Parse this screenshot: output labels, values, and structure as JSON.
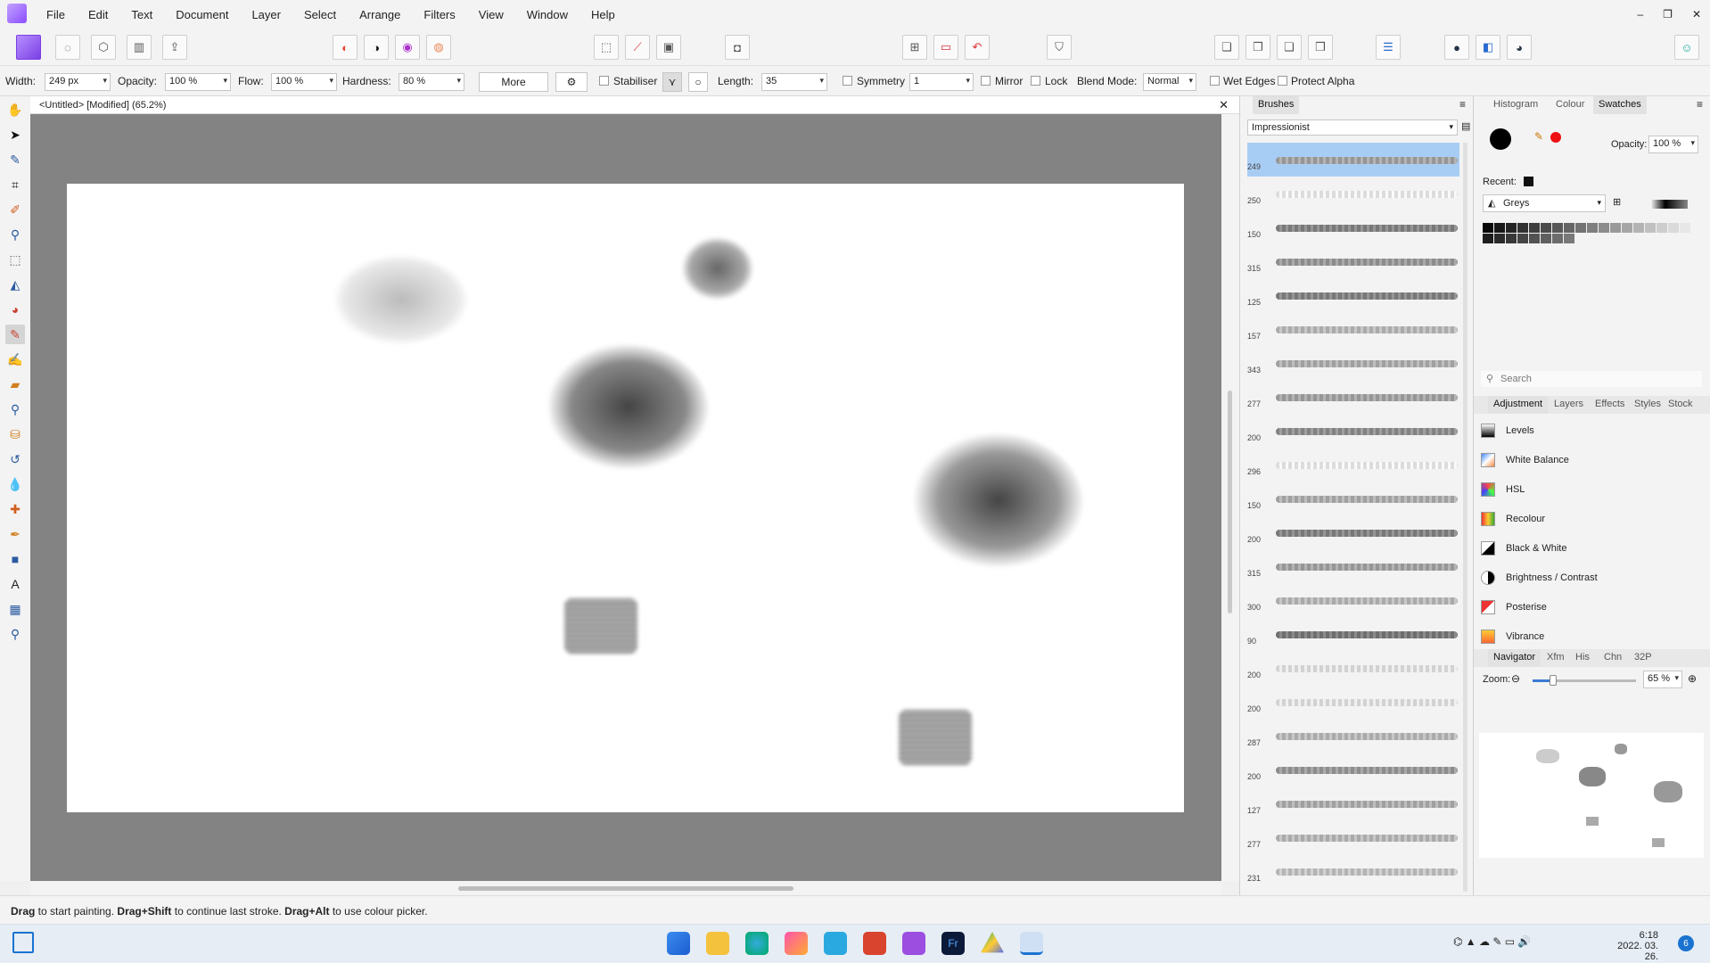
{
  "app": {
    "name": "Affinity Photo"
  },
  "menu": [
    "File",
    "Edit",
    "Text",
    "Document",
    "Layer",
    "Select",
    "Arrange",
    "Filters",
    "View",
    "Window",
    "Help"
  ],
  "window_controls": [
    "–",
    "❐",
    "✕"
  ],
  "context": {
    "width_label": "Width:",
    "width_value": "249 px",
    "opacity_label": "Opacity:",
    "opacity_value": "100 %",
    "flow_label": "Flow:",
    "flow_value": "100 %",
    "hardness_label": "Hardness:",
    "hardness_value": "80 %",
    "more_label": "More",
    "stabiliser_label": "Stabiliser",
    "length_label": "Length:",
    "length_value": "35",
    "symmetry_label": "Symmetry",
    "symmetry_value": "1",
    "mirror_label": "Mirror",
    "lock_label": "Lock",
    "blend_label": "Blend Mode:",
    "blend_value": "Normal",
    "wet_edges_label": "Wet Edges",
    "protect_alpha_label": "Protect Alpha"
  },
  "document": {
    "title": "<Untitled> [Modified] (65.2%)"
  },
  "brushes": {
    "tab": "Brushes",
    "category": "Impressionist",
    "sizes": [
      "249",
      "250",
      "150",
      "315",
      "125",
      "157",
      "343",
      "277",
      "200",
      "296",
      "150",
      "200",
      "315",
      "300",
      "90",
      "200",
      "200",
      "287",
      "200",
      "127",
      "277",
      "231"
    ]
  },
  "right_panel": {
    "top_tabs": [
      "Histogram",
      "Colour",
      "Swatches"
    ],
    "opacity_label": "Opacity:",
    "opacity_value": "100 %",
    "recent_label": "Recent:",
    "palette": "Greys",
    "search_placeholder": "Search",
    "studio_tabs": [
      "Adjustment",
      "Layers",
      "Effects",
      "Styles",
      "Stock"
    ],
    "adjustments": [
      "Levels",
      "White Balance",
      "HSL",
      "Recolour",
      "Black & White",
      "Brightness / Contrast",
      "Posterise",
      "Vibrance"
    ],
    "nav_tabs": [
      "Navigator",
      "Xfm",
      "His",
      "Chn",
      "32P"
    ],
    "zoom_label": "Zoom:",
    "zoom_value": "65 %",
    "zoom_level": 0.65
  },
  "status": {
    "drag": "Drag",
    "t1": " to start painting. ",
    "drag_shift": "Drag+Shift",
    "t2": " to continue last stroke. ",
    "drag_alt": "Drag+Alt",
    "t3": " to use colour picker."
  },
  "taskbar": {
    "time": "6:18",
    "date": "2022. 03. 26.",
    "notif_count": "6"
  }
}
